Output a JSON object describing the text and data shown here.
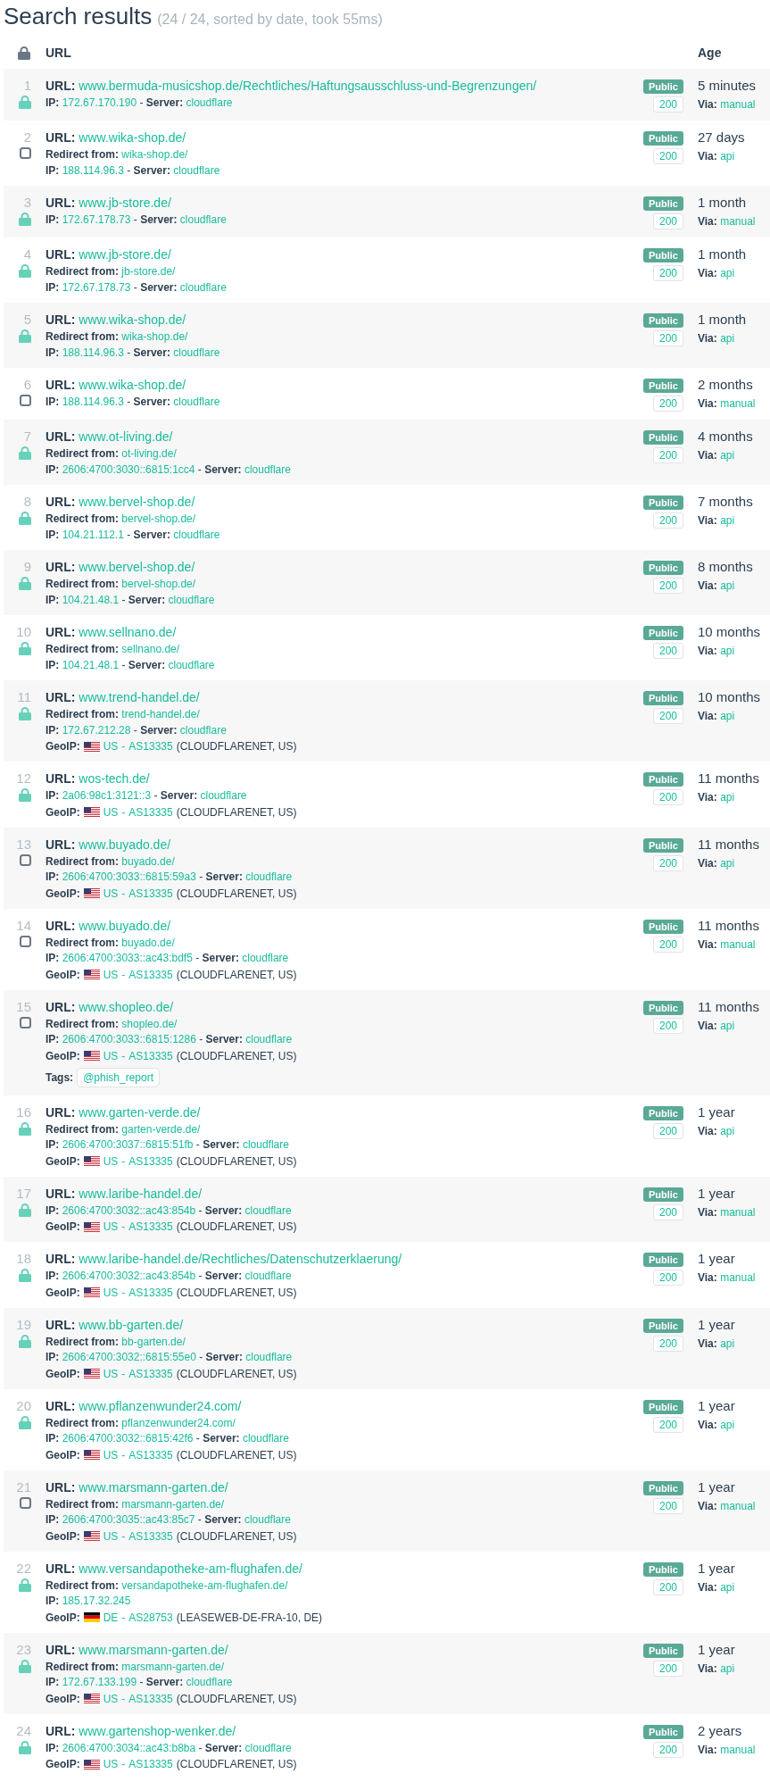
{
  "title": "Search results",
  "summary": "(24 / 24, sorted by date, took 55ms)",
  "columns": [
    "URL",
    "Age"
  ],
  "results": [
    {
      "index": "1",
      "https": true,
      "url": {
        "label": "URL:",
        "value": "www.bermuda-musicshop.de/Rechtliches/Haftungsausschluss-und-Begrenzungen/"
      },
      "ip": {
        "label": "IP:",
        "value": "172.67.170.190",
        "separator": "-",
        "server_label": "Server:",
        "server": "cloudflare"
      },
      "visibility": "Public",
      "status": "200",
      "age": "5 minutes",
      "via": {
        "label": "Via:",
        "value": "manual"
      }
    },
    {
      "index": "2",
      "https": false,
      "url": {
        "label": "URL:",
        "value": "www.wika-shop.de/"
      },
      "redirect": {
        "label": "Redirect from:",
        "value": "wika-shop.de/"
      },
      "ip": {
        "label": "IP:",
        "value": "188.114.96.3",
        "separator": "-",
        "server_label": "Server:",
        "server": "cloudflare"
      },
      "visibility": "Public",
      "status": "200",
      "age": "27 days",
      "via": {
        "label": "Via:",
        "value": "api"
      }
    },
    {
      "index": "3",
      "https": true,
      "url": {
        "label": "URL:",
        "value": "www.jb-store.de/"
      },
      "ip": {
        "label": "IP:",
        "value": "172.67.178.73",
        "separator": "-",
        "server_label": "Server:",
        "server": "cloudflare"
      },
      "visibility": "Public",
      "status": "200",
      "age": "1 month",
      "via": {
        "label": "Via:",
        "value": "manual"
      }
    },
    {
      "index": "4",
      "https": true,
      "url": {
        "label": "URL:",
        "value": "www.jb-store.de/"
      },
      "redirect": {
        "label": "Redirect from:",
        "value": "jb-store.de/"
      },
      "ip": {
        "label": "IP:",
        "value": "172.67.178.73",
        "separator": "-",
        "server_label": "Server:",
        "server": "cloudflare"
      },
      "visibility": "Public",
      "status": "200",
      "age": "1 month",
      "via": {
        "label": "Via:",
        "value": "api"
      }
    },
    {
      "index": "5",
      "https": true,
      "url": {
        "label": "URL:",
        "value": "www.wika-shop.de/"
      },
      "redirect": {
        "label": "Redirect from:",
        "value": "wika-shop.de/"
      },
      "ip": {
        "label": "IP:",
        "value": "188.114.96.3",
        "separator": "-",
        "server_label": "Server:",
        "server": "cloudflare"
      },
      "visibility": "Public",
      "status": "200",
      "age": "1 month",
      "via": {
        "label": "Via:",
        "value": "api"
      }
    },
    {
      "index": "6",
      "https": false,
      "url": {
        "label": "URL:",
        "value": "www.wika-shop.de/"
      },
      "ip": {
        "label": "IP:",
        "value": "188.114.96.3",
        "separator": "-",
        "server_label": "Server:",
        "server": "cloudflare"
      },
      "visibility": "Public",
      "status": "200",
      "age": "2 months",
      "via": {
        "label": "Via:",
        "value": "manual"
      }
    },
    {
      "index": "7",
      "https": true,
      "url": {
        "label": "URL:",
        "value": "www.ot-living.de/"
      },
      "redirect": {
        "label": "Redirect from:",
        "value": "ot-living.de/"
      },
      "ip": {
        "label": "IP:",
        "value": "2606:4700:3030::6815:1cc4",
        "separator": "-",
        "server_label": "Server:",
        "server": "cloudflare"
      },
      "visibility": "Public",
      "status": "200",
      "age": "4 months",
      "via": {
        "label": "Via:",
        "value": "api"
      }
    },
    {
      "index": "8",
      "https": true,
      "url": {
        "label": "URL:",
        "value": "www.bervel-shop.de/"
      },
      "redirect": {
        "label": "Redirect from:",
        "value": "bervel-shop.de/"
      },
      "ip": {
        "label": "IP:",
        "value": "104.21.112.1",
        "separator": "-",
        "server_label": "Server:",
        "server": "cloudflare"
      },
      "visibility": "Public",
      "status": "200",
      "age": "7 months",
      "via": {
        "label": "Via:",
        "value": "api"
      }
    },
    {
      "index": "9",
      "https": true,
      "url": {
        "label": "URL:",
        "value": "www.bervel-shop.de/"
      },
      "redirect": {
        "label": "Redirect from:",
        "value": "bervel-shop.de/"
      },
      "ip": {
        "label": "IP:",
        "value": "104.21.48.1",
        "separator": "-",
        "server_label": "Server:",
        "server": "cloudflare"
      },
      "visibility": "Public",
      "status": "200",
      "age": "8 months",
      "via": {
        "label": "Via:",
        "value": "api"
      }
    },
    {
      "index": "10",
      "https": true,
      "url": {
        "label": "URL:",
        "value": "www.sellnano.de/"
      },
      "redirect": {
        "label": "Redirect from:",
        "value": "sellnano.de/"
      },
      "ip": {
        "label": "IP:",
        "value": "104.21.48.1",
        "separator": "-",
        "server_label": "Server:",
        "server": "cloudflare"
      },
      "visibility": "Public",
      "status": "200",
      "age": "10 months",
      "via": {
        "label": "Via:",
        "value": "api"
      }
    },
    {
      "index": "11",
      "https": true,
      "url": {
        "label": "URL:",
        "value": "www.trend-handel.de/"
      },
      "redirect": {
        "label": "Redirect from:",
        "value": "trend-handel.de/"
      },
      "ip": {
        "label": "IP:",
        "value": "172.67.212.28",
        "separator": "-",
        "server_label": "Server:",
        "server": "cloudflare"
      },
      "geoip": {
        "label": "GeoIP:",
        "kind": "us",
        "country": "US",
        "separator": "-",
        "asn": "AS13335",
        "network": "(CLOUDFLARENET, US)"
      },
      "visibility": "Public",
      "status": "200",
      "age": "10 months",
      "via": {
        "label": "Via:",
        "value": "api"
      }
    },
    {
      "index": "12",
      "https": true,
      "url": {
        "label": "URL:",
        "value": "wos-tech.de/"
      },
      "ip": {
        "label": "IP:",
        "value": "2a06:98c1:3121::3",
        "separator": "-",
        "server_label": "Server:",
        "server": "cloudflare"
      },
      "geoip": {
        "label": "GeoIP:",
        "kind": "us",
        "country": "US",
        "separator": "-",
        "asn": "AS13335",
        "network": "(CLOUDFLARENET, US)"
      },
      "visibility": "Public",
      "status": "200",
      "age": "11 months",
      "via": {
        "label": "Via:",
        "value": "api"
      }
    },
    {
      "index": "13",
      "https": false,
      "url": {
        "label": "URL:",
        "value": "www.buyado.de/"
      },
      "redirect": {
        "label": "Redirect from:",
        "value": "buyado.de/"
      },
      "ip": {
        "label": "IP:",
        "value": "2606:4700:3033::6815:59a3",
        "separator": "-",
        "server_label": "Server:",
        "server": "cloudflare"
      },
      "geoip": {
        "label": "GeoIP:",
        "kind": "us",
        "country": "US",
        "separator": "-",
        "asn": "AS13335",
        "network": "(CLOUDFLARENET, US)"
      },
      "visibility": "Public",
      "status": "200",
      "age": "11 months",
      "via": {
        "label": "Via:",
        "value": "api"
      }
    },
    {
      "index": "14",
      "https": false,
      "url": {
        "label": "URL:",
        "value": "www.buyado.de/"
      },
      "redirect": {
        "label": "Redirect from:",
        "value": "buyado.de/"
      },
      "ip": {
        "label": "IP:",
        "value": "2606:4700:3033::ac43:bdf5",
        "separator": "-",
        "server_label": "Server:",
        "server": "cloudflare"
      },
      "geoip": {
        "label": "GeoIP:",
        "kind": "us",
        "country": "US",
        "separator": "-",
        "asn": "AS13335",
        "network": "(CLOUDFLARENET, US)"
      },
      "visibility": "Public",
      "status": "200",
      "age": "11 months",
      "via": {
        "label": "Via:",
        "value": "manual"
      }
    },
    {
      "index": "15",
      "https": false,
      "url": {
        "label": "URL:",
        "value": "www.shopleo.de/"
      },
      "redirect": {
        "label": "Redirect from:",
        "value": "shopleo.de/"
      },
      "ip": {
        "label": "IP:",
        "value": "2606:4700:3033::6815:1286",
        "separator": "-",
        "server_label": "Server:",
        "server": "cloudflare"
      },
      "geoip": {
        "label": "GeoIP:",
        "kind": "us",
        "country": "US",
        "separator": "-",
        "asn": "AS13335",
        "network": "(CLOUDFLARENET, US)"
      },
      "tags": {
        "label": "Tags:",
        "items": [
          "@phish_report"
        ]
      },
      "visibility": "Public",
      "status": "200",
      "age": "11 months",
      "via": {
        "label": "Via:",
        "value": "api"
      }
    },
    {
      "index": "16",
      "https": true,
      "url": {
        "label": "URL:",
        "value": "www.garten-verde.de/"
      },
      "redirect": {
        "label": "Redirect from:",
        "value": "garten-verde.de/"
      },
      "ip": {
        "label": "IP:",
        "value": "2606:4700:3037::6815:51fb",
        "separator": "-",
        "server_label": "Server:",
        "server": "cloudflare"
      },
      "geoip": {
        "label": "GeoIP:",
        "kind": "us",
        "country": "US",
        "separator": "-",
        "asn": "AS13335",
        "network": "(CLOUDFLARENET, US)"
      },
      "visibility": "Public",
      "status": "200",
      "age": "1 year",
      "via": {
        "label": "Via:",
        "value": "api"
      }
    },
    {
      "index": "17",
      "https": true,
      "url": {
        "label": "URL:",
        "value": "www.laribe-handel.de/"
      },
      "ip": {
        "label": "IP:",
        "value": "2606:4700:3032::ac43:854b",
        "separator": "-",
        "server_label": "Server:",
        "server": "cloudflare"
      },
      "geoip": {
        "label": "GeoIP:",
        "kind": "us",
        "country": "US",
        "separator": "-",
        "asn": "AS13335",
        "network": "(CLOUDFLARENET, US)"
      },
      "visibility": "Public",
      "status": "200",
      "age": "1 year",
      "via": {
        "label": "Via:",
        "value": "manual"
      }
    },
    {
      "index": "18",
      "https": true,
      "url": {
        "label": "URL:",
        "value": "www.laribe-handel.de/Rechtliches/Datenschutzerklaerung/"
      },
      "ip": {
        "label": "IP:",
        "value": "2606:4700:3032::ac43:854b",
        "separator": "-",
        "server_label": "Server:",
        "server": "cloudflare"
      },
      "geoip": {
        "label": "GeoIP:",
        "kind": "us",
        "country": "US",
        "separator": "-",
        "asn": "AS13335",
        "network": "(CLOUDFLARENET, US)"
      },
      "visibility": "Public",
      "status": "200",
      "age": "1 year",
      "via": {
        "label": "Via:",
        "value": "manual"
      }
    },
    {
      "index": "19",
      "https": true,
      "url": {
        "label": "URL:",
        "value": "www.bb-garten.de/"
      },
      "redirect": {
        "label": "Redirect from:",
        "value": "bb-garten.de/"
      },
      "ip": {
        "label": "IP:",
        "value": "2606:4700:3032::6815:55e0",
        "separator": "-",
        "server_label": "Server:",
        "server": "cloudflare"
      },
      "geoip": {
        "label": "GeoIP:",
        "kind": "us",
        "country": "US",
        "separator": "-",
        "asn": "AS13335",
        "network": "(CLOUDFLARENET, US)"
      },
      "visibility": "Public",
      "status": "200",
      "age": "1 year",
      "via": {
        "label": "Via:",
        "value": "api"
      }
    },
    {
      "index": "20",
      "https": true,
      "url": {
        "label": "URL:",
        "value": "www.pflanzenwunder24.com/"
      },
      "redirect": {
        "label": "Redirect from:",
        "value": "pflanzenwunder24.com/"
      },
      "ip": {
        "label": "IP:",
        "value": "2606:4700:3032::6815:42f6",
        "separator": "-",
        "server_label": "Server:",
        "server": "cloudflare"
      },
      "geoip": {
        "label": "GeoIP:",
        "kind": "us",
        "country": "US",
        "separator": "-",
        "asn": "AS13335",
        "network": "(CLOUDFLARENET, US)"
      },
      "visibility": "Public",
      "status": "200",
      "age": "1 year",
      "via": {
        "label": "Via:",
        "value": "api"
      }
    },
    {
      "index": "21",
      "https": false,
      "url": {
        "label": "URL:",
        "value": "www.marsmann-garten.de/"
      },
      "redirect": {
        "label": "Redirect from:",
        "value": "marsmann-garten.de/"
      },
      "ip": {
        "label": "IP:",
        "value": "2606:4700:3035::ac43:85c7",
        "separator": "-",
        "server_label": "Server:",
        "server": "cloudflare"
      },
      "geoip": {
        "label": "GeoIP:",
        "kind": "us",
        "country": "US",
        "separator": "-",
        "asn": "AS13335",
        "network": "(CLOUDFLARENET, US)"
      },
      "visibility": "Public",
      "status": "200",
      "age": "1 year",
      "via": {
        "label": "Via:",
        "value": "manual"
      }
    },
    {
      "index": "22",
      "https": true,
      "url": {
        "label": "URL:",
        "value": "www.versandapotheke-am-flughafen.de/"
      },
      "redirect": {
        "label": "Redirect from:",
        "value": "versandapotheke-am-flughafen.de/"
      },
      "ip": {
        "label": "IP:",
        "value": "185.17.32.245"
      },
      "geoip": {
        "label": "GeoIP:",
        "kind": "de",
        "country": "DE",
        "separator": "-",
        "asn": "AS28753",
        "network": "(LEASEWEB-DE-FRA-10, DE)"
      },
      "visibility": "Public",
      "status": "200",
      "age": "1 year",
      "via": {
        "label": "Via:",
        "value": "api"
      }
    },
    {
      "index": "23",
      "https": true,
      "url": {
        "label": "URL:",
        "value": "www.marsmann-garten.de/"
      },
      "redirect": {
        "label": "Redirect from:",
        "value": "marsmann-garten.de/"
      },
      "ip": {
        "label": "IP:",
        "value": "172.67.133.199",
        "separator": "-",
        "server_label": "Server:",
        "server": "cloudflare"
      },
      "geoip": {
        "label": "GeoIP:",
        "kind": "us",
        "country": "US",
        "separator": "-",
        "asn": "AS13335",
        "network": "(CLOUDFLARENET, US)"
      },
      "visibility": "Public",
      "status": "200",
      "age": "1 year",
      "via": {
        "label": "Via:",
        "value": "api"
      }
    },
    {
      "index": "24",
      "https": true,
      "url": {
        "label": "URL:",
        "value": "www.gartenshop-wenker.de/"
      },
      "ip": {
        "label": "IP:",
        "value": "2606:4700:3034::ac43:b8ba",
        "separator": "-",
        "server_label": "Server:",
        "server": "cloudflare"
      },
      "geoip": {
        "label": "GeoIP:",
        "kind": "us",
        "country": "US",
        "separator": "-",
        "asn": "AS13335",
        "network": "(CLOUDFLARENET, US)"
      },
      "visibility": "Public",
      "status": "200",
      "age": "2 years",
      "via": {
        "label": "Via:",
        "value": "manual"
      }
    }
  ]
}
